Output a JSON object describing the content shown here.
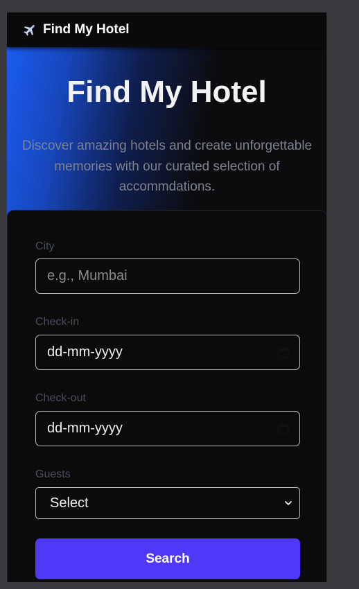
{
  "navbar": {
    "brand": "Find My Hotel",
    "logo_icon": "airplane-icon"
  },
  "hero": {
    "title": "Find My Hotel",
    "subtitle": "Discover amazing hotels and create unforgettable memories with our curated selection of accommdations."
  },
  "form": {
    "city": {
      "label": "City",
      "placeholder": "e.g., Mumbai"
    },
    "checkin": {
      "label": "Check-in",
      "value": "dd-mm-yyyy",
      "icon": "calendar-icon"
    },
    "checkout": {
      "label": "Check-out",
      "value": "dd-mm-yyyy",
      "icon": "calendar-icon"
    },
    "guests": {
      "label": "Guests",
      "selected": "Select",
      "icon": "chevron-down-icon"
    },
    "search_label": "Search"
  },
  "colors": {
    "accent": "#4f39f6",
    "gradient_blue": "#1b5cf0",
    "background": "#0c0c0d"
  }
}
